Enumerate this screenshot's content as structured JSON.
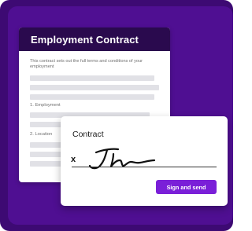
{
  "document": {
    "title": "Employment Contract",
    "intro": "This contract sets out the full terms and conditions of your employment",
    "section_1": "1. Employment",
    "section_2": "2. Location"
  },
  "sign_card": {
    "title": "Contract",
    "x_label": "x",
    "button_label": "Sign and send"
  },
  "colors": {
    "frame": "#3d0a73",
    "panel": "#4f0f92",
    "doc_header": "#2a0a4e",
    "button": "#7a1fd8"
  }
}
